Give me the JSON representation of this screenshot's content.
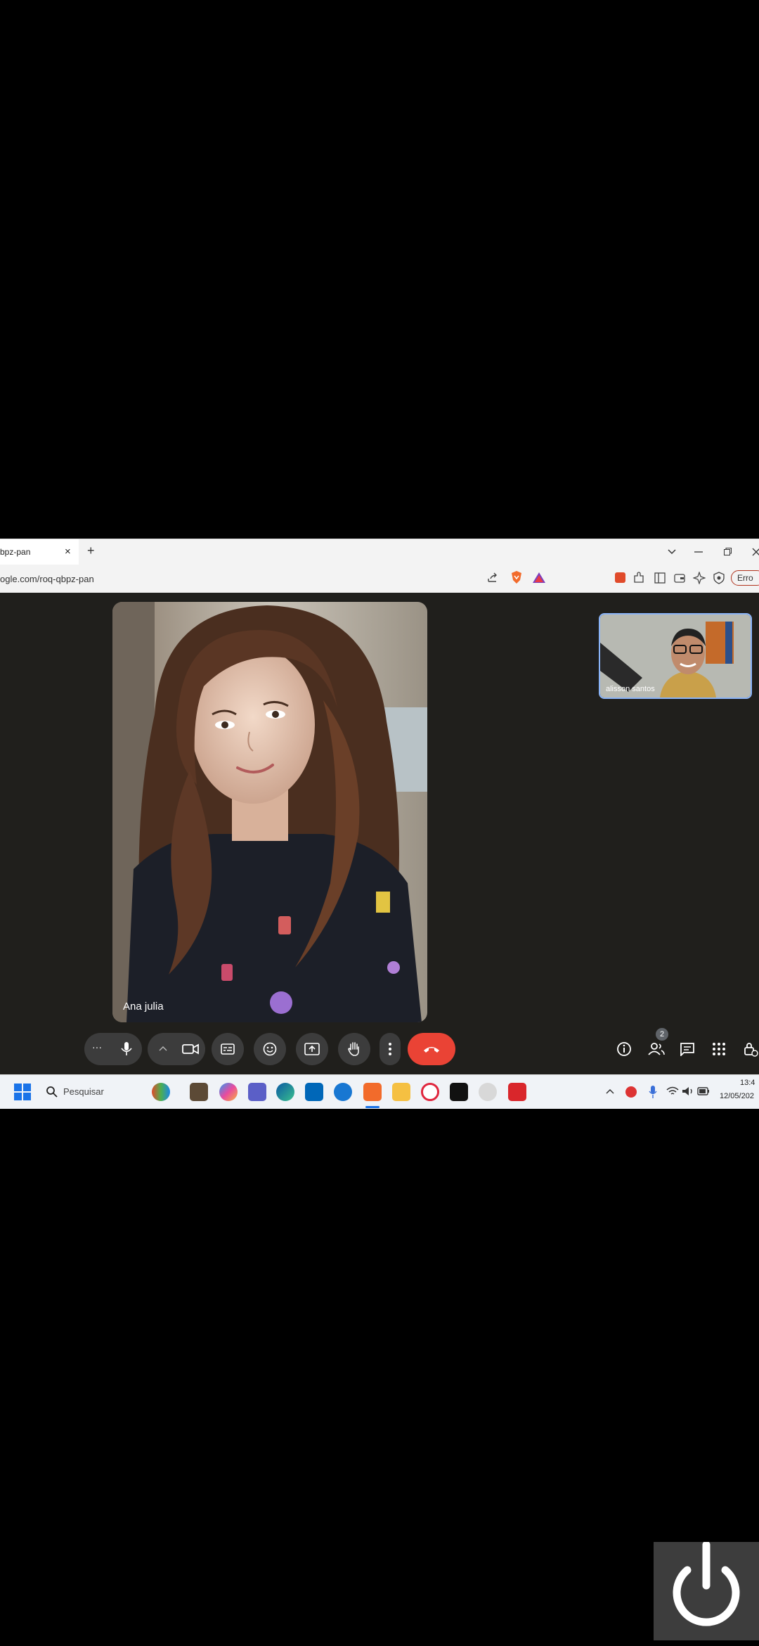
{
  "browser": {
    "tab_title": "bpz-pan",
    "tab_close": "×",
    "new_tab": "+",
    "url": "ogle.com/roq-qbpz-pan",
    "error_label": "Erro"
  },
  "meet": {
    "main_participant_name": "Ana julia",
    "self_participant_name": "alisson santos",
    "participants_count": "2",
    "more_label": "···"
  },
  "taskbar": {
    "search_placeholder": "Pesquisar",
    "time": "13:4",
    "date": "12/05/202"
  },
  "colors": {
    "meet_bg": "#201f1c",
    "end_call": "#ea4335",
    "accent": "#8ab4f8"
  }
}
